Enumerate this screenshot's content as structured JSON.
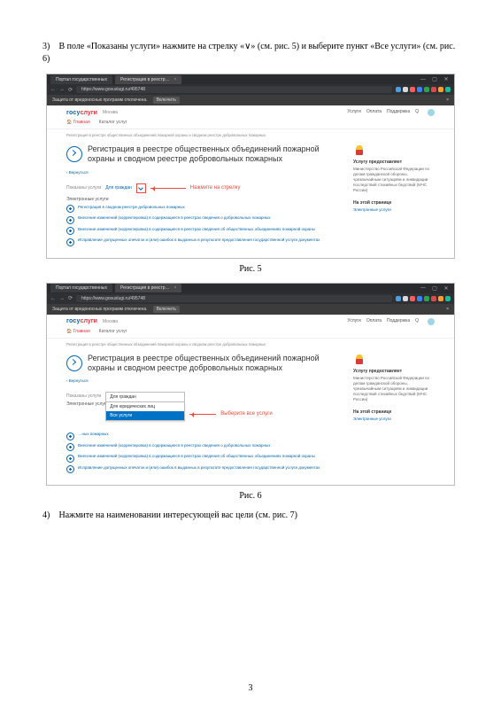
{
  "instructions": {
    "i3_num": "3)",
    "i3_text": "В поле «Показаны услуги» нажмите на стрелку «∨» (см. рис. 5) и выберите пункт «Все услуги» (см. рис. 6)",
    "i4_num": "4)",
    "i4_text": "Нажмите на наименовании интересующей вас цели (см. рис. 7)"
  },
  "captions": {
    "fig5": "Рис. 5",
    "fig6": "Рис. 6"
  },
  "browser": {
    "tab1": "Портал государственных",
    "tab2": "Регистрация в реестр…",
    "url": "https://www.gosuslugi.ru/495748",
    "warning": "Защита от вредоносных программ отключена.",
    "warn_btn": "Включить",
    "win": {
      "min": "—",
      "max": "▢",
      "close": "✕"
    }
  },
  "ext_colors": [
    "#4b9fe0",
    "#d8d8d8",
    "#ff5c5c",
    "#3a82f7",
    "#2aa44f",
    "#d94b4b",
    "#ff9e2c",
    "#1abc9c"
  ],
  "site": {
    "logo1": "госу",
    "logo2": "слуги",
    "city": "Москва",
    "menu": {
      "services": "Услуги",
      "payment": "Оплата",
      "support": "Поддержка",
      "search": "Q"
    },
    "nav": {
      "main": "Главная",
      "catalog": "Каталог услуг"
    },
    "breadcrumb": "Регистрация в реестре общественных объединений пожарной охраны и сводном реестре добровольных пожарных",
    "title": "Регистрация в реестре общественных объединений пожарной охраны и сводном реестре добровольных пожарных",
    "back": "‹ Вернуться",
    "shown_label": "Показаны услуги",
    "shown_value": "Для граждан",
    "section": "Электронные услуги",
    "services": {
      "s1": "Регистрация в сводном реестре добровольных пожарных",
      "s2": "Внесение изменений (корректировка) в содержащиеся в реестрах сведения о добровольных пожарных",
      "s3": "Внесение изменений (корректировка) в содержащиеся в реестрах сведения об общественных объединениях пожарной охраны",
      "s4": "Исправление допущенных опечаток и (или) ошибок в выданных в результате предоставления государственной услуги документах"
    },
    "side": {
      "h1": "Услугу предоставляет",
      "body": "Министерство Российской Федерации по делам гражданской обороны, чрезвычайным ситуациям и ликвидации последствий стихийных бедствий (МЧС России)",
      "h2": "На этой странице",
      "link": "Электронные услуги"
    }
  },
  "callouts": {
    "fig5": "Нажмите на стрелку",
    "fig6": "Выберите все услуги"
  },
  "dropdown": {
    "sel": "Для граждан",
    "opt1": "Для юридических лиц",
    "opt2": "Все услуги"
  },
  "truncated": {
    "s1_short": "…ных пожарных"
  },
  "page_number": "3"
}
